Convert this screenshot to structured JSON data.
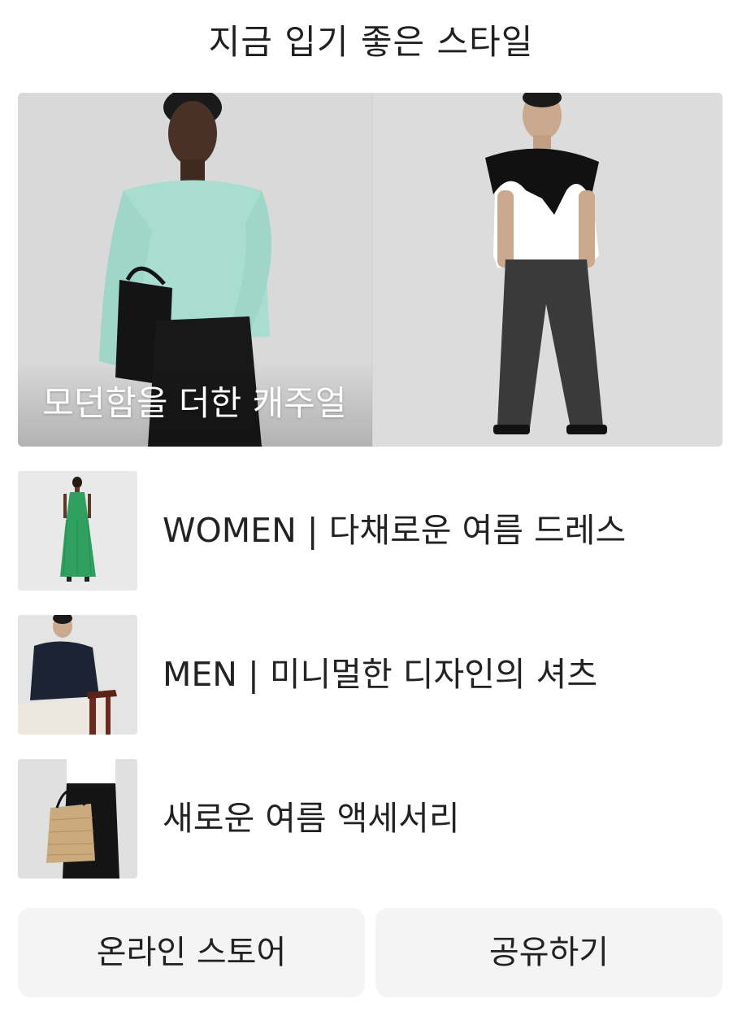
{
  "header": {
    "title": "지금 입기 좋은 스타일"
  },
  "hero": {
    "caption": "모던함을 더한 캐주얼",
    "left_image": "woman in mint sweatshirt with black bag",
    "right_image": "man in white t-shirt with black sweater over shoulders"
  },
  "items": [
    {
      "label": "WOMEN | 다채로운 여름 드레스",
      "image": "woman in green pleated dress"
    },
    {
      "label": "MEN | 미니멀한 디자인의 셔츠",
      "image": "man in navy shirt seated"
    },
    {
      "label": "새로운 여름 액세서리",
      "image": "woven straw tote bag"
    }
  ],
  "buttons": {
    "store": "온라인 스토어",
    "share": "공유하기"
  },
  "colors": {
    "background": "#ffffff",
    "button_bg": "#f4f4f4",
    "text": "#222222"
  }
}
